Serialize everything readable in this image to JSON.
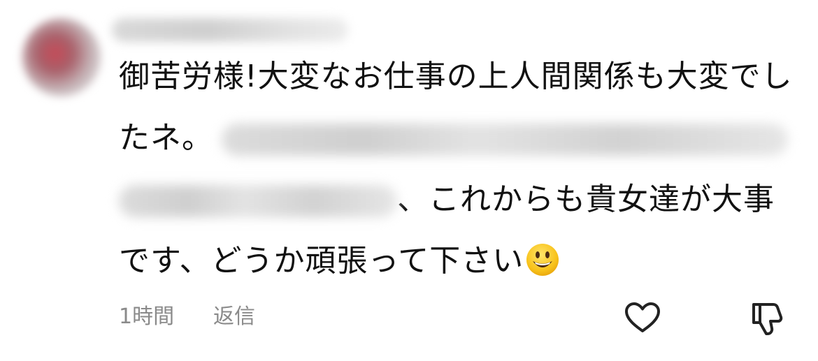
{
  "comment": {
    "line1": "御苦労様!大変なお仕事の上人間関係も大変でし",
    "line2_start": "たネ。",
    "line3_end": "、これからも貴女達が大事",
    "line4": "です、どうか頑張って下さい",
    "emoji": "smiling-face-emoji"
  },
  "meta": {
    "time": "1時間",
    "reply_label": "返信"
  },
  "actions": {
    "like_icon": "heart-icon",
    "dislike_icon": "thumbs-down-icon"
  },
  "colors": {
    "text": "#111111",
    "meta_text": "#8a8a8a",
    "icon_stroke": "#222222"
  }
}
